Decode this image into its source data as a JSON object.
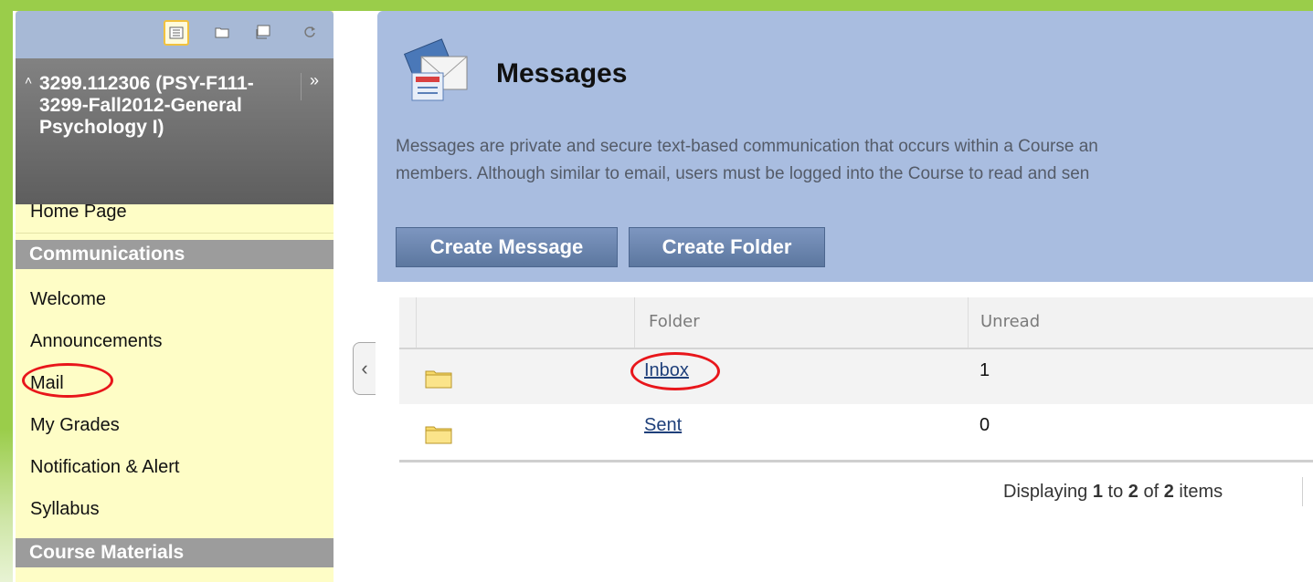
{
  "sidebar": {
    "toolbar": {
      "tools": [
        {
          "icon": "list-view-icon",
          "active": true
        },
        {
          "icon": "folder-view-icon",
          "active": false
        },
        {
          "icon": "window-view-icon",
          "active": false
        },
        {
          "icon": "refresh-icon",
          "active": false
        }
      ]
    },
    "course_title": "3299.112306 (PSY-F111-3299-Fall2012-General Psychology I)",
    "items": {
      "home": "Home Page",
      "welcome": "Welcome",
      "announcements": "Announcements",
      "mail": "Mail",
      "grades": "My Grades",
      "notification": "Notification & Alert",
      "syllabus": "Syllabus"
    },
    "headers": {
      "communications": "Communications",
      "course_materials": "Course Materials"
    }
  },
  "main": {
    "title": "Messages",
    "description_line1": "Messages are private and secure text-based communication that occurs within a Course an",
    "description_line2": "members. Although similar to email, users must be logged into the Course to read and sen",
    "buttons": {
      "create_message": "Create Message",
      "create_folder": "Create Folder"
    },
    "table": {
      "columns": [
        "",
        "Folder",
        "Unread"
      ],
      "rows": [
        {
          "folder": "Inbox",
          "unread": "1"
        },
        {
          "folder": "Sent",
          "unread": "0"
        }
      ]
    },
    "paging": {
      "prefix": "Displaying",
      "from": "1",
      "to_word": "to",
      "to": "2",
      "of_word": "of",
      "total": "2",
      "suffix": "items"
    }
  },
  "colors": {
    "annotation": "#e8161b",
    "sidebar_bg": "#fefdc6",
    "header_bg": "#a9bde0"
  }
}
